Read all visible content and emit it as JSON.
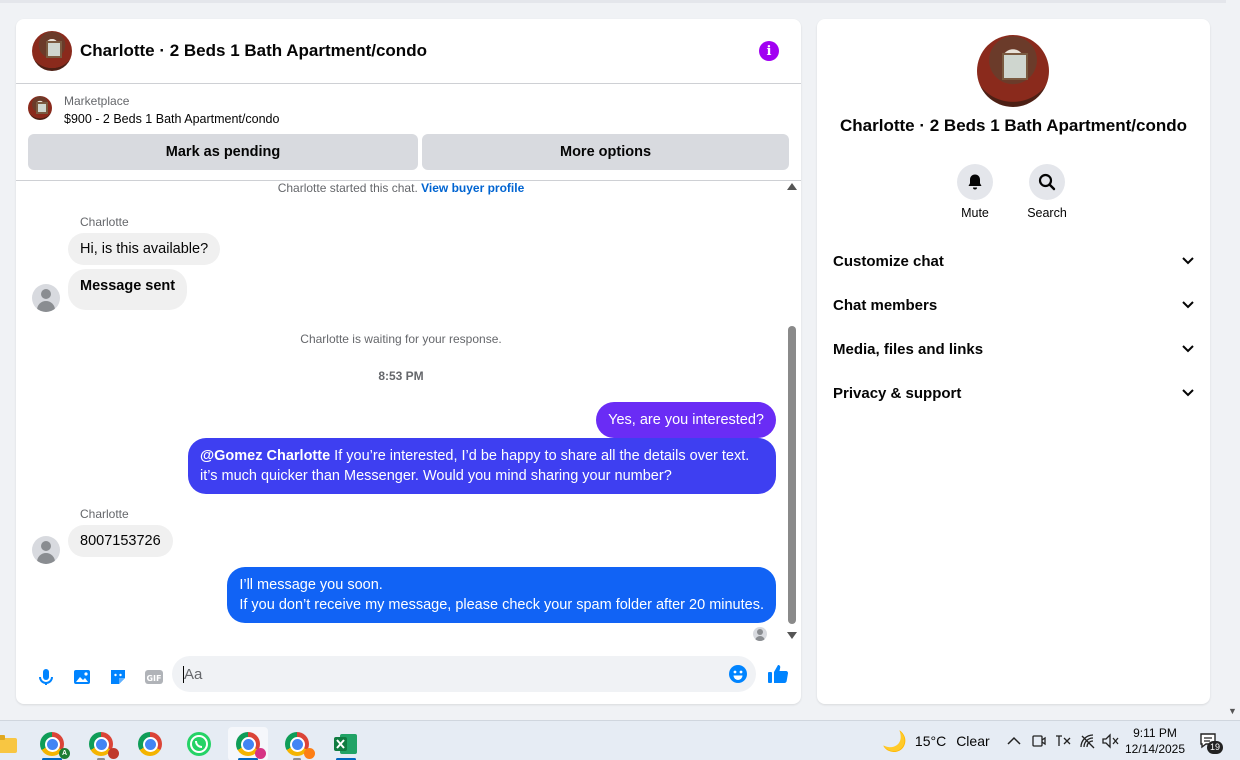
{
  "chat": {
    "title": "Charlotte · 2 Beds 1 Bath Apartment/condo",
    "listing": {
      "label": "Marketplace",
      "price_title": "$900 - 2 Beds 1 Bath Apartment/condo",
      "pending_button": "Mark as pending",
      "options_button": "More options"
    },
    "started_text": "Charlotte started this chat.",
    "buyer_profile_link": "View buyer profile",
    "messages": {
      "sender_1": "Charlotte",
      "in_1": "Hi, is this available?",
      "in_2": "Message sent",
      "waiting": "Charlotte is waiting for your response.",
      "time": "8:53 PM",
      "out_1": "Yes, are you interested?",
      "out_2_mention": "@Gomez Charlotte",
      "out_2_text": " If you’re interested, I’d be happy to share all the details over text. it’s much quicker than Messenger. Would you mind sharing your number?",
      "sender_2": "Charlotte",
      "in_3": "8007153726",
      "out_3_line1": "I’ll message you soon.",
      "out_3_line2": "If you don’t receive my message, please check your spam folder after 20 minutes."
    },
    "composer": {
      "placeholder": "Aa",
      "gif_label": "GIF"
    }
  },
  "details": {
    "title": "Charlotte · 2 Beds 1 Bath Apartment/condo",
    "mute_label": "Mute",
    "search_label": "Search",
    "sections": [
      "Customize chat",
      "Chat members",
      "Media, files and links",
      "Privacy & support"
    ]
  },
  "taskbar": {
    "temperature": "15°C",
    "condition": "Clear",
    "time": "9:11 PM",
    "date": "12/14/2025",
    "notification_count": "19"
  },
  "colors": {
    "accent": "#0084ff",
    "bubble_purple": "#6a2cf5",
    "bubble_indigo": "#3e3ff1",
    "bubble_blue": "#1163f5",
    "info_purple": "#a100f2"
  }
}
